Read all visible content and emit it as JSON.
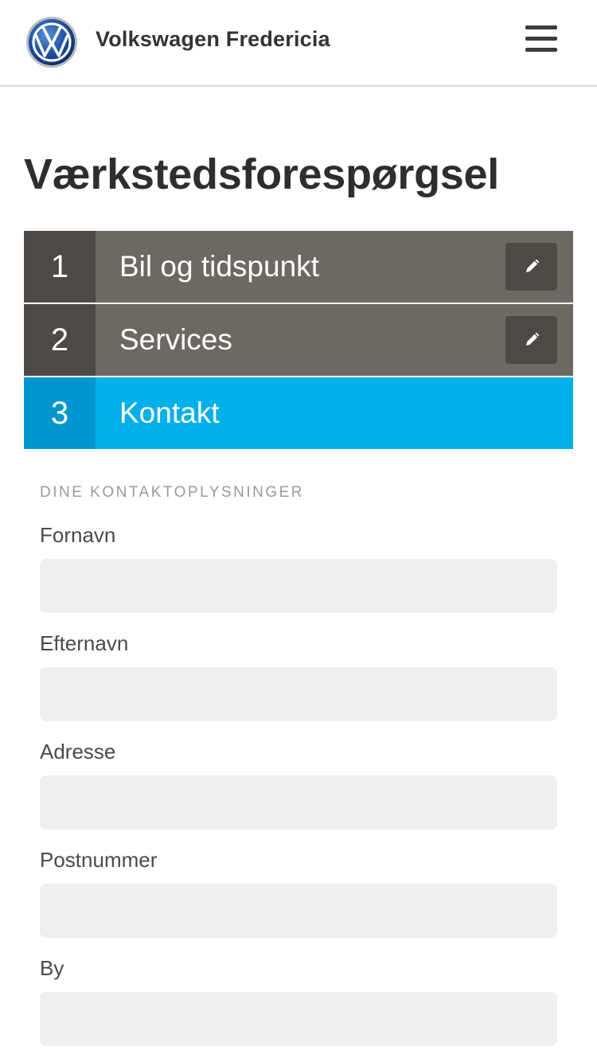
{
  "header": {
    "brand": "Volkswagen Fredericia",
    "logo_icon": "vw-logo-icon",
    "menu_icon": "hamburger-menu-icon"
  },
  "page": {
    "title": "Værkstedsforespørgsel"
  },
  "steps": [
    {
      "number": "1",
      "label": "Bil og tidspunkt",
      "state": "done",
      "edit_icon": "pencil-icon"
    },
    {
      "number": "2",
      "label": "Services",
      "state": "done",
      "edit_icon": "pencil-icon"
    },
    {
      "number": "3",
      "label": "Kontakt",
      "state": "active"
    }
  ],
  "form": {
    "section_caption": "DINE KONTAKTOPLYSNINGER",
    "fields": [
      {
        "label": "Fornavn",
        "value": ""
      },
      {
        "label": "Efternavn",
        "value": ""
      },
      {
        "label": "Adresse",
        "value": ""
      },
      {
        "label": "Postnummer",
        "value": ""
      },
      {
        "label": "By",
        "value": ""
      }
    ]
  },
  "colors": {
    "step_done_number": "#4d4a45",
    "step_done_label": "#6c6963",
    "step_active_number": "#0096cd",
    "step_active_label": "#00b0e8",
    "input_background": "#efefef"
  }
}
